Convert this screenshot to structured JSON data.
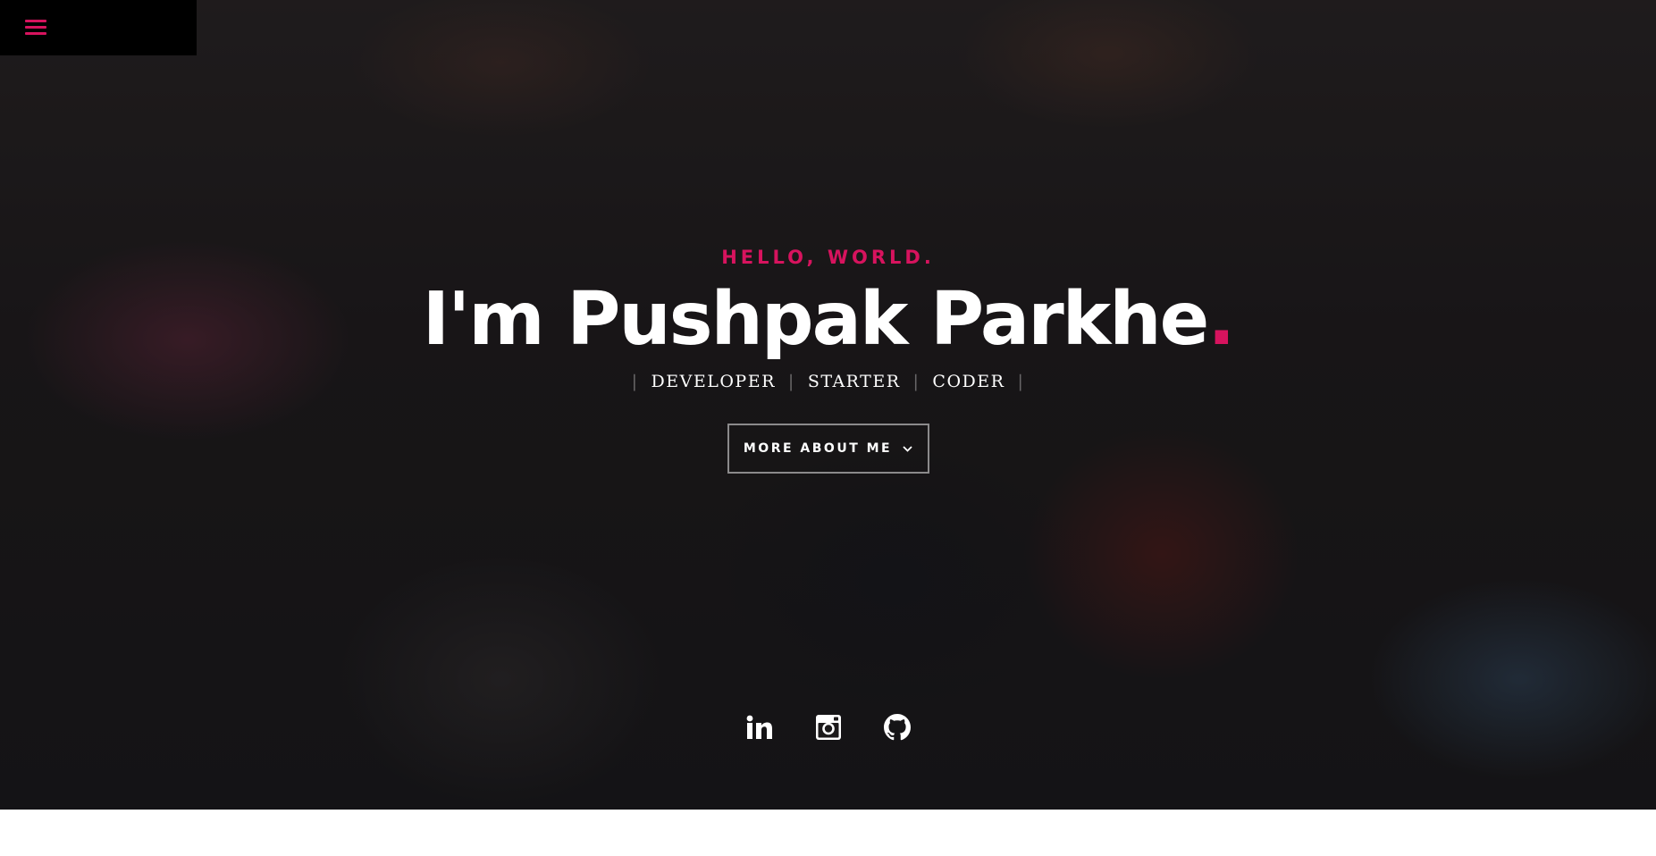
{
  "theme": {
    "accent": "#d7135e",
    "text": "#ffffff"
  },
  "nav": {
    "menu_icon": "hamburger-menu-icon"
  },
  "intro": {
    "greeting": "HELLO, WORLD.",
    "name_text": "I'm Pushpak Parkhe",
    "name_dot": ".",
    "roles": [
      "DEVELOPER",
      "STARTER",
      "CODER"
    ],
    "role_separator": "|"
  },
  "cta": {
    "label": "MORE ABOUT ME",
    "icon": "chevron-down-icon"
  },
  "social": [
    {
      "name": "LinkedIn",
      "icon": "linkedin-icon"
    },
    {
      "name": "Instagram",
      "icon": "instagram-icon"
    },
    {
      "name": "GitHub",
      "icon": "github-icon"
    }
  ]
}
